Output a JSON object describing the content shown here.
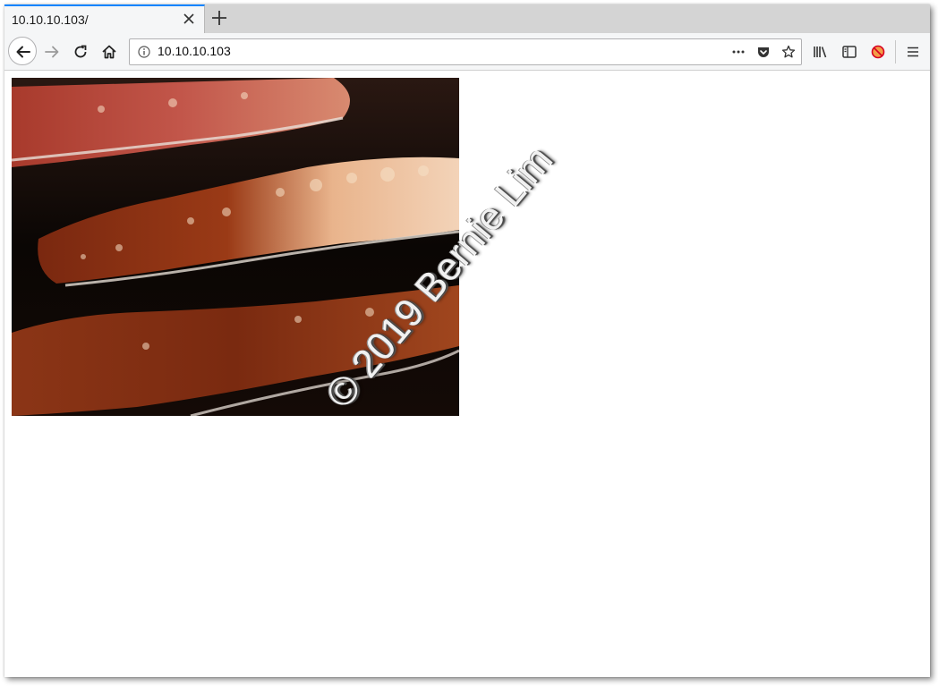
{
  "browser": {
    "tab": {
      "title": "10.10.10.103/"
    },
    "urlbar": {
      "url": "10.10.10.103"
    }
  },
  "page": {
    "image_description": "strips of bacon frying in a pan",
    "watermark": "© 2019 Bernie Lim"
  },
  "colors": {
    "tab_accent": "#0a84ff",
    "toolbar_bg": "#f5f6f7",
    "tabstrip_bg": "#d4d4d4",
    "bacon_meat": "#8a2a14",
    "bacon_fat": "#e8c6a8",
    "pan_dark": "#0d0705"
  }
}
